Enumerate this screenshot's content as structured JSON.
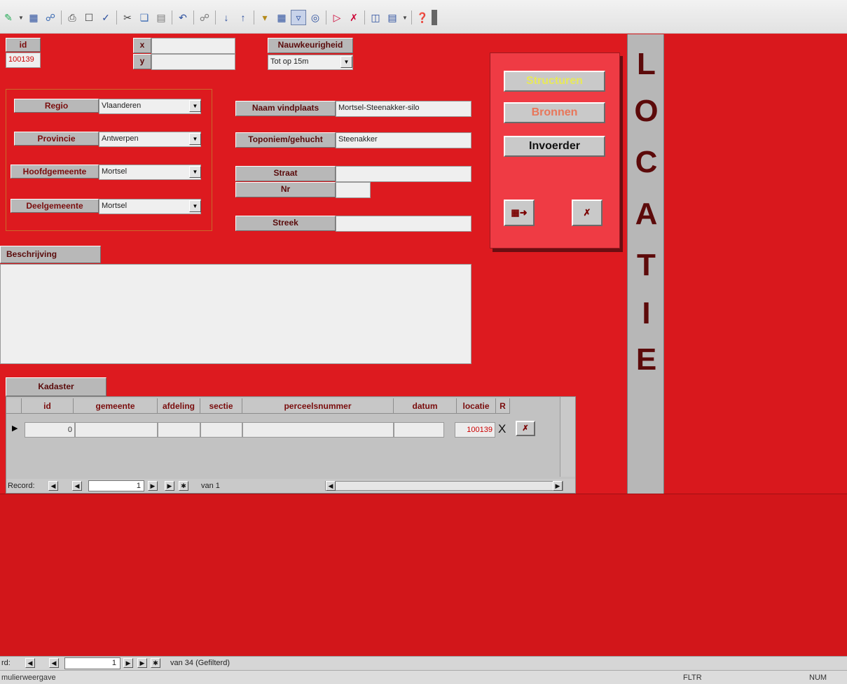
{
  "toolbar": {
    "icons": [
      "design-view-icon",
      "save-icon",
      "search-db-icon",
      "print-icon",
      "print-preview-icon",
      "spelling-icon",
      "cut-icon",
      "copy-icon",
      "paste-icon",
      "undo-icon",
      "hyperlink-icon",
      "sort-ascending-icon",
      "sort-descending-icon",
      "filter-by-selection-icon",
      "filter-by-form-icon",
      "apply-filter-icon",
      "find-icon",
      "new-record-icon",
      "delete-record-icon",
      "database-window-icon",
      "new-object-icon",
      "help-icon"
    ]
  },
  "form": {
    "id_label": "id",
    "id_value": "100139",
    "x_label": "x",
    "y_label": "y",
    "x_value": "",
    "y_value": "",
    "nauwkeurigheid_label": "Nauwkeurigheid",
    "nauwkeurigheid_value": "Tot op 15m",
    "regio_label": "Regio",
    "regio_value": "Vlaanderen",
    "provincie_label": "Provincie",
    "provincie_value": "Antwerpen",
    "hoofdgemeente_label": "Hoofdgemeente",
    "hoofdgemeente_value": "Mortsel",
    "deelgemeente_label": "Deelgemeente",
    "deelgemeente_value": "Mortsel",
    "naam_vindplaats_label": "Naam vindplaats",
    "naam_vindplaats_value": "Mortsel-Steenakker-silo",
    "toponiem_label": "Toponiem/gehucht",
    "toponiem_value": "Steenakker",
    "straat_label": "Straat",
    "straat_value": "",
    "nr_label": "Nr",
    "nr_value": "",
    "streek_label": "Streek",
    "streek_value": "",
    "beschrijving_label": "Beschrijving",
    "beschrijving_value": ""
  },
  "panel": {
    "structuren_label": "Structuren",
    "bronnen_label": "Bronnen",
    "invoerder_label": "Invoerder",
    "colors": {
      "structuren_text": "#e8e85a",
      "bronnen_text": "#e8765a",
      "invoerder_text": "#111111"
    }
  },
  "vertical_title": [
    "L",
    "O",
    "C",
    "A",
    "T",
    "I",
    "E"
  ],
  "kadaster": {
    "tab_label": "Kadaster",
    "columns": [
      "id",
      "gemeente",
      "afdeling",
      "sectie",
      "perceelsnummer",
      "datum",
      "locatie",
      "R"
    ],
    "row": {
      "id": "0",
      "locatie": "100139",
      "x_label": "X"
    },
    "record_label": "Record:",
    "record_current": "1",
    "record_total": "van 1"
  },
  "navigation": {
    "record_label": "rd:",
    "record_current": "1",
    "record_total": "van 34 (Gefilterd)"
  },
  "status": {
    "view_text": "mulierweergave",
    "fltr": "FLTR",
    "num": "NUM"
  }
}
